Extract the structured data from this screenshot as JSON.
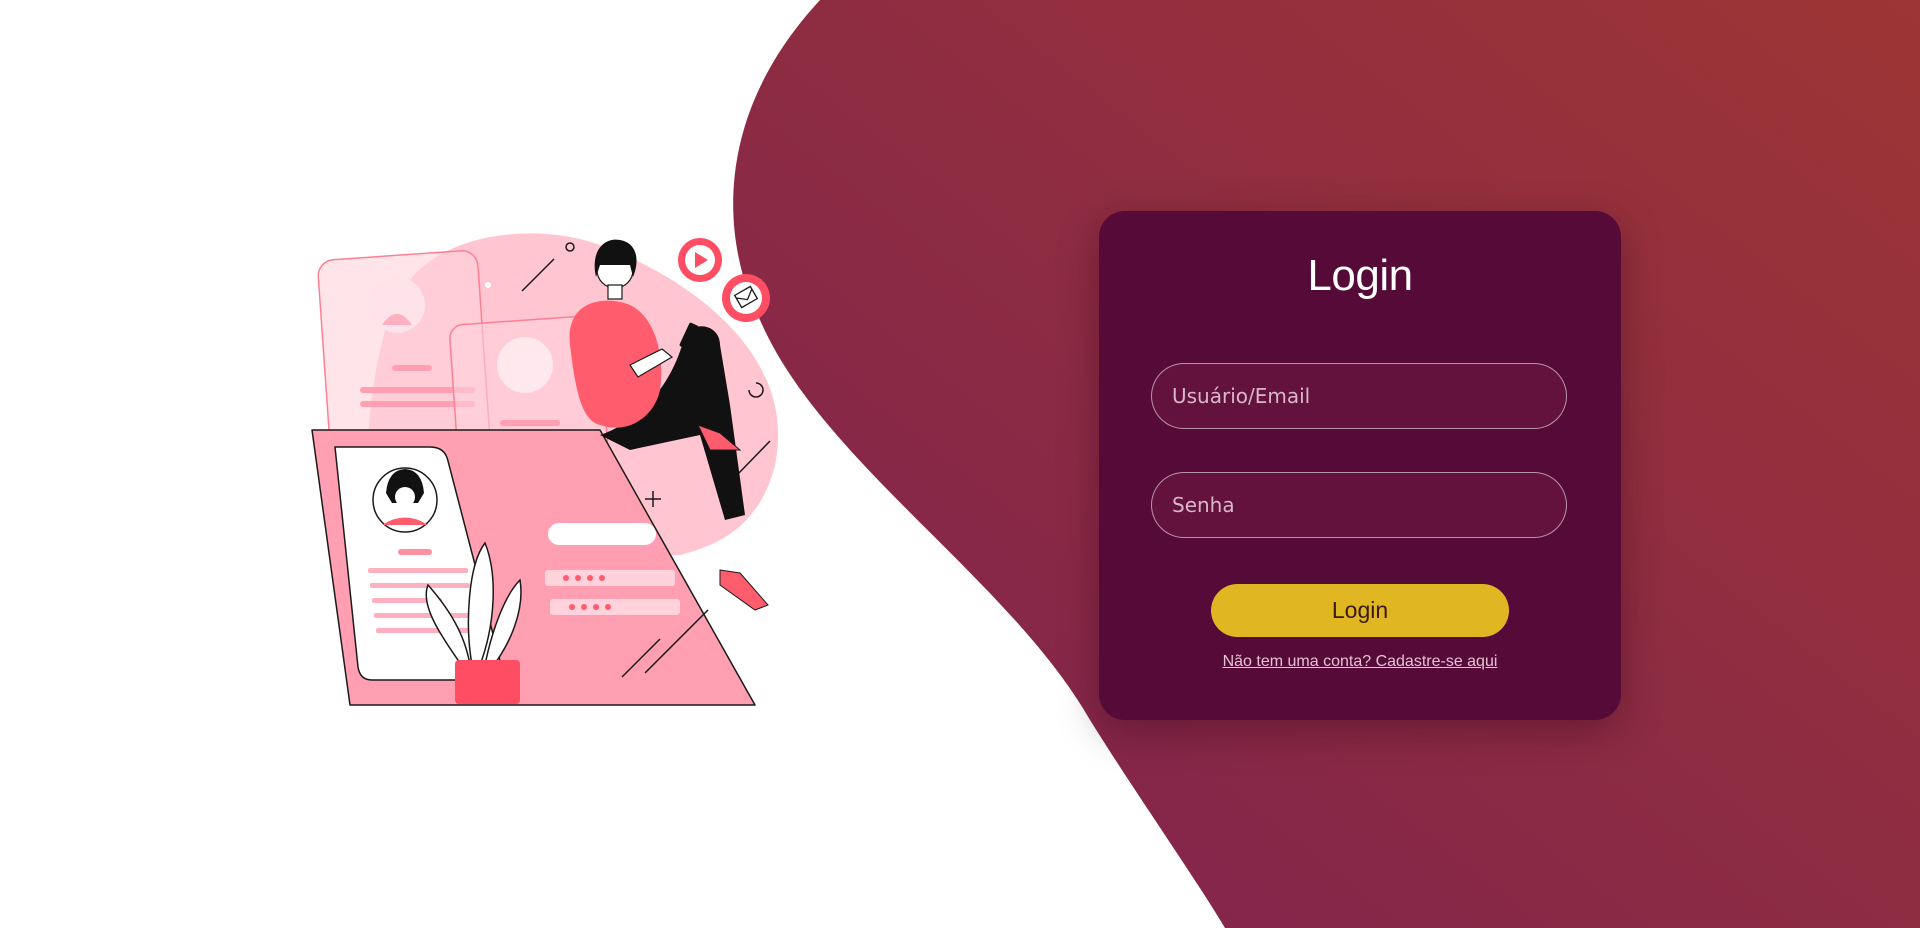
{
  "theme": {
    "background": "#ffffff",
    "wave_gradient": [
      "#82254a",
      "#9a3536"
    ],
    "card": "#560a38",
    "button": "#e0b722",
    "illustration_pink": "#ff5c6e"
  },
  "login": {
    "title": "Login",
    "username_placeholder": "Usuário/Email",
    "password_placeholder": "Senha",
    "submit_label": "Login",
    "signup_link": "Não tem uma conta? Cadastre-se aqui"
  },
  "illustration": {
    "icons": [
      "play-icon",
      "mail-icon",
      "avatar-icon",
      "plant-icon"
    ]
  }
}
